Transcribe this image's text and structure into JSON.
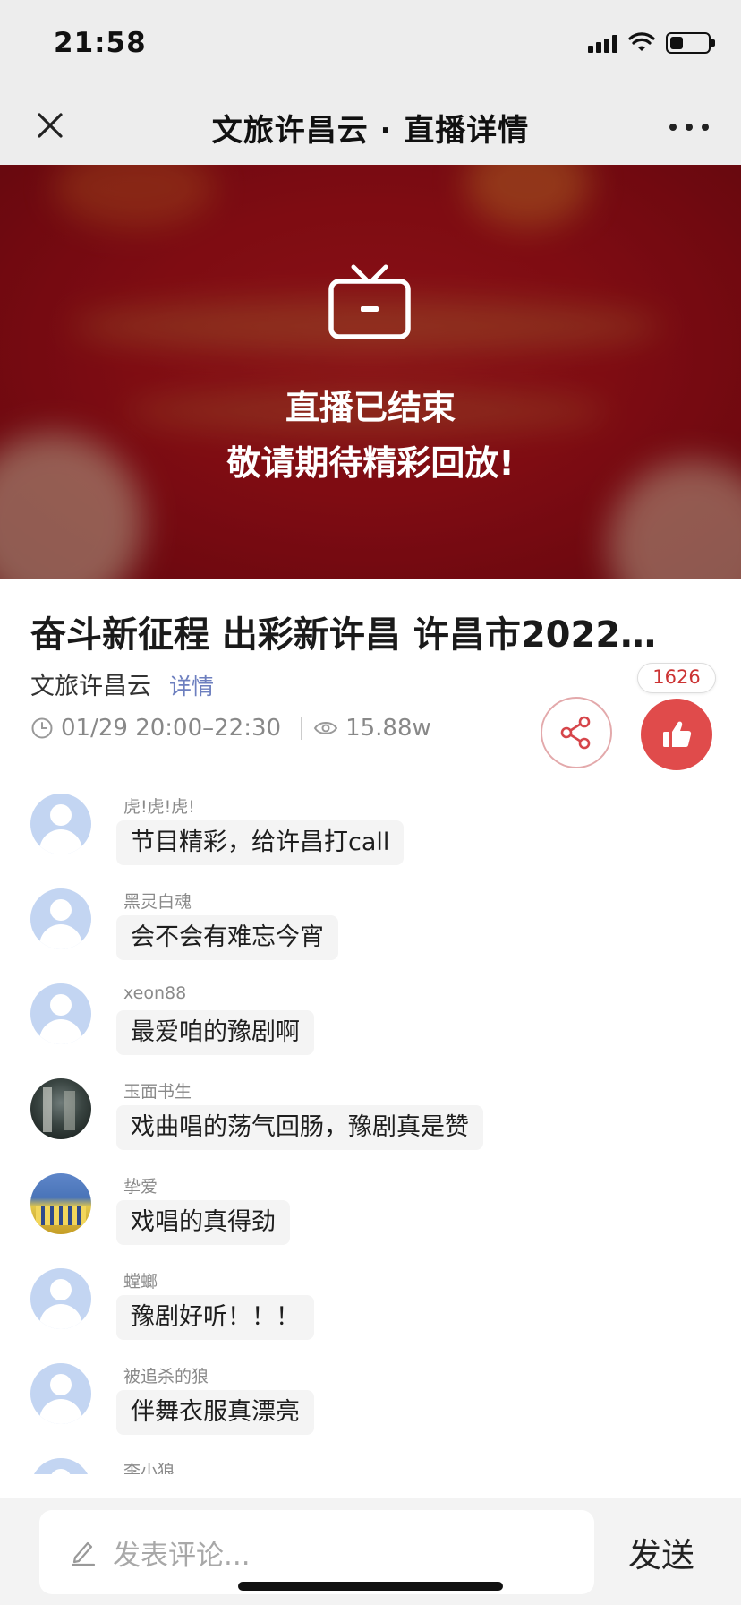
{
  "status_bar": {
    "time": "21:58",
    "battery_level": 0.3
  },
  "nav": {
    "title": "文旅许昌云 · 直播详情"
  },
  "video": {
    "line1": "直播已结束",
    "line2": "敬请期待精彩回放!"
  },
  "live": {
    "title": "奋斗新征程 出彩新许昌 许昌市2022…",
    "author": "文旅许昌云",
    "detail_link": "详情",
    "time": "01/29 20:00–22:30",
    "views": "15.88w",
    "like_count": "1626"
  },
  "comments": [
    {
      "user": "虎!虎!虎!",
      "text": "节目精彩，给许昌打call",
      "avatar": "default"
    },
    {
      "user": "黑灵白魂",
      "text": "会不会有难忘今宵",
      "avatar": "default"
    },
    {
      "user": "xeon88",
      "text": "最爱咱的豫剧啊",
      "avatar": "default"
    },
    {
      "user": "玉面书生",
      "text": "戏曲唱的荡气回肠，豫剧真是赞",
      "avatar": "photo"
    },
    {
      "user": "挚爱",
      "text": "戏唱的真得劲",
      "avatar": "photo"
    },
    {
      "user": "螳螂",
      "text": "豫剧好听！！！",
      "avatar": "default"
    },
    {
      "user": "被追杀的狼",
      "text": "伴舞衣服真漂亮",
      "avatar": "default"
    },
    {
      "user": "李小狼",
      "text": "",
      "avatar": "default"
    }
  ],
  "comment_input": {
    "placeholder": "发表评论...",
    "send_label": "发送"
  },
  "colors": {
    "accent_red": "#e04b4b",
    "video_red": "#9b0f17",
    "link_blue": "#6d7fbf"
  }
}
